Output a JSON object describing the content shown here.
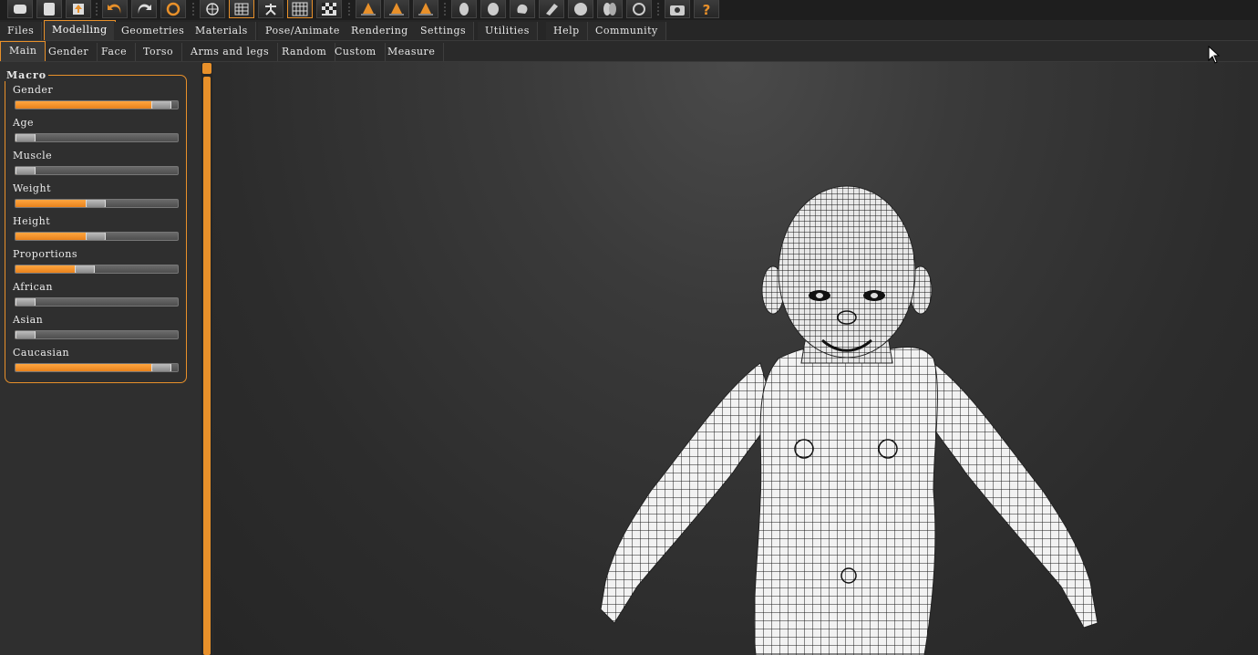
{
  "toolbar": {
    "buttons": [
      "new-icon",
      "save-icon",
      "export-icon",
      "undo-icon",
      "redo-icon",
      "reset-icon",
      "smooth-icon",
      "wireframe-icon",
      "pose-icon",
      "grid-icon",
      "checker-icon",
      "front-view-icon",
      "back-view-icon",
      "side-view-icon",
      "face-icon",
      "head-icon",
      "hands-icon",
      "feet-icon",
      "sphere-icon",
      "body-icon",
      "camera-reset-icon",
      "screenshot-icon",
      "help-icon"
    ]
  },
  "main_tabs": [
    "Files",
    "Modelling",
    "Geometries",
    "Materials",
    "Pose/Animate",
    "Rendering",
    "Settings",
    "Utilities",
    "Help",
    "Community"
  ],
  "main_tab_active": "Modelling",
  "sub_tabs": [
    "Main",
    "Gender",
    "Face",
    "Torso",
    "Arms and legs",
    "Random",
    "Custom",
    "Measure"
  ],
  "sub_tab_active": "Main",
  "macro": {
    "title": "Macro",
    "sliders": [
      {
        "label": "Gender",
        "value": 0.94
      },
      {
        "label": "Age",
        "value": 0.0
      },
      {
        "label": "Muscle",
        "value": 0.0
      },
      {
        "label": "Weight",
        "value": 0.49
      },
      {
        "label": "Height",
        "value": 0.49
      },
      {
        "label": "Proportions",
        "value": 0.41
      },
      {
        "label": "African",
        "value": 0.0
      },
      {
        "label": "Asian",
        "value": 0.0
      },
      {
        "label": "Caucasian",
        "value": 0.94
      }
    ]
  },
  "colors": {
    "accent": "#e8902a",
    "background": "#2b2b2b"
  }
}
